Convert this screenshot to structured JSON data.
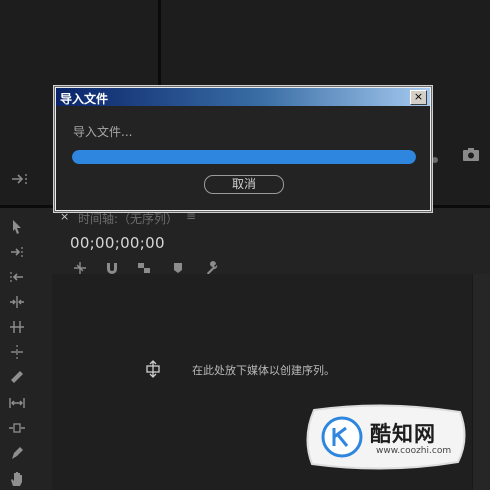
{
  "dialog": {
    "title": "导入文件",
    "message": "导入文件...",
    "progress": 1.0,
    "cancel_label": "取消",
    "close_glyph": "×"
  },
  "timeline": {
    "close_glyph": "×",
    "title": "时间轴:（无序列）",
    "menu_glyph": "≡",
    "timecode": "00;00;00;00",
    "drop_hint": "在此处放下媒体以创建序列。"
  },
  "watermark": {
    "brand": "酷知网",
    "url": "www.coozhi.com"
  },
  "colors": {
    "accent": "#2e86de",
    "titlebar": "#0a246a",
    "panel": "#232323"
  }
}
